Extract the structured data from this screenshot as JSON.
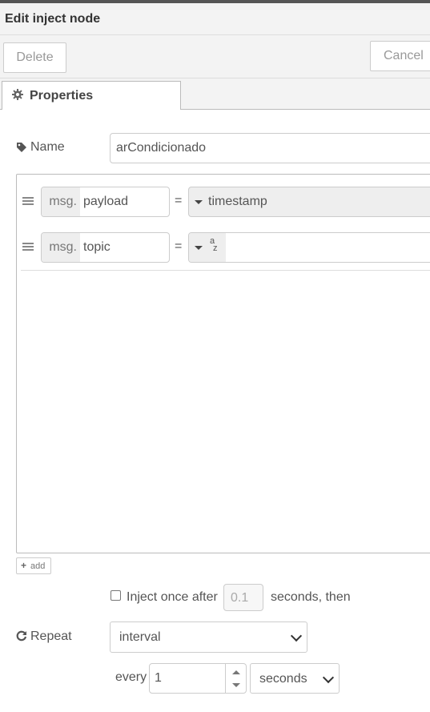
{
  "header": {
    "title": "Edit inject node"
  },
  "actions": {
    "delete_label": "Delete",
    "cancel_label": "Cancel"
  },
  "tabs": [
    {
      "label": "Properties",
      "icon": "gear-icon"
    }
  ],
  "name_field": {
    "label": "Name",
    "icon": "tag-icon",
    "value": "arCondicionado"
  },
  "properties": [
    {
      "prefix": "msg.",
      "key": "payload",
      "operator": "=",
      "type_icon": "caret-down-icon",
      "value": "timestamp"
    },
    {
      "prefix": "msg.",
      "key": "topic",
      "operator": "=",
      "type_icon": "string-type-icon",
      "type_glyph_top": "a",
      "type_glyph_bottom": "z",
      "value": ""
    }
  ],
  "add_button": {
    "label": "add",
    "icon": "plus-icon"
  },
  "inject_once": {
    "checked": false,
    "label": "Inject once after",
    "delay_placeholder": "0.1",
    "suffix": "seconds, then"
  },
  "repeat": {
    "label": "Repeat",
    "icon": "repeat-icon",
    "selected": "interval",
    "every_label": "every",
    "every_value": "1",
    "unit": "seconds"
  },
  "colors": {
    "border": "#cccccc",
    "header_bg": "#f3f3f3",
    "prefix_bg": "#eeeeee"
  }
}
